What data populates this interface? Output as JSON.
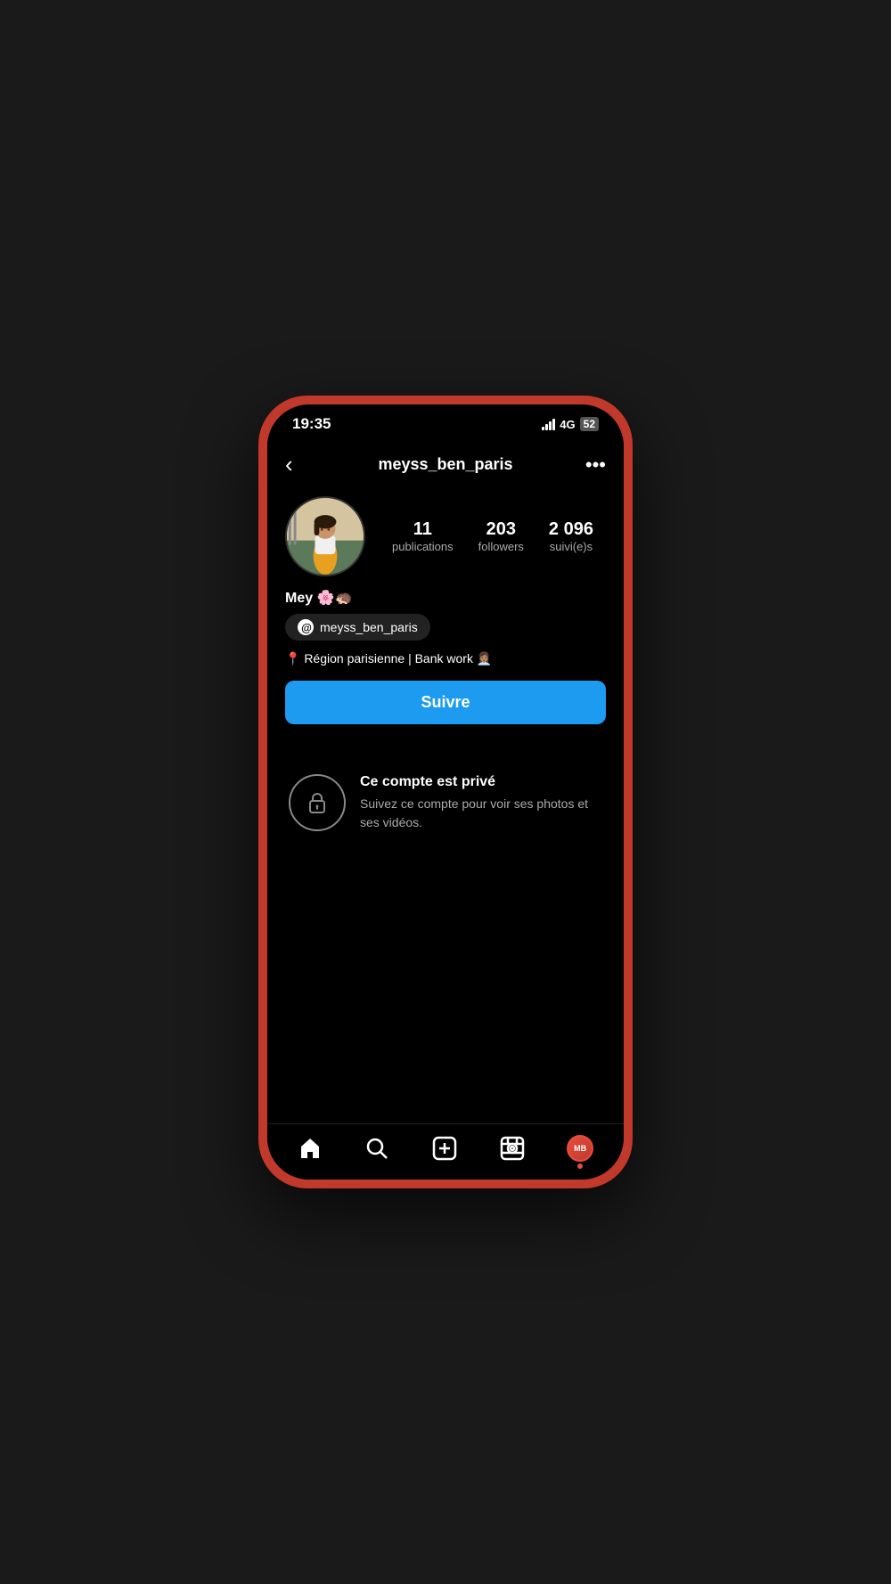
{
  "status_bar": {
    "time": "19:35",
    "network": "4G",
    "battery": "52"
  },
  "header": {
    "back_label": "‹",
    "username": "meyss_ben_paris",
    "more_label": "•••"
  },
  "profile": {
    "name": "Mey 🌸🦔",
    "threads_handle": "meyss_ben_paris",
    "bio": "📍 Région parisienne | Bank work 👩🏽‍💼",
    "stats": [
      {
        "number": "11",
        "label": "publications"
      },
      {
        "number": "203",
        "label": "followers"
      },
      {
        "number": "2 096",
        "label": "suivi(e)s"
      }
    ],
    "follow_button_label": "Suivre"
  },
  "private_account": {
    "title": "Ce compte est privé",
    "description": "Suivez ce compte pour voir ses photos et ses vidéos."
  },
  "bottom_nav": [
    {
      "name": "home",
      "icon": "⌂"
    },
    {
      "name": "search",
      "icon": "○"
    },
    {
      "name": "add",
      "icon": "⊕"
    },
    {
      "name": "reels",
      "icon": "▷"
    },
    {
      "name": "profile",
      "icon": "avatar"
    }
  ]
}
